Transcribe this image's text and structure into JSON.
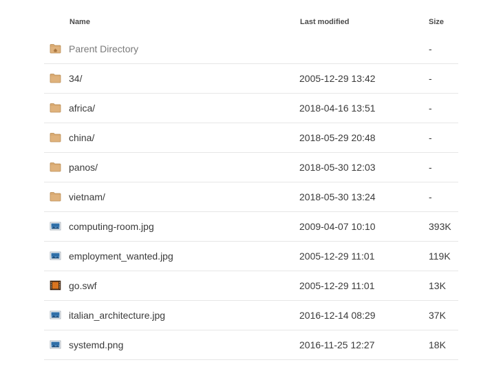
{
  "columns": {
    "name": "Name",
    "last_modified": "Last modified",
    "size": "Size"
  },
  "rows": [
    {
      "name": "Parent Directory",
      "modified": "",
      "size": "-",
      "icon": "parent-folder-icon"
    },
    {
      "name": "34/",
      "modified": "2005-12-29 13:42",
      "size": "-",
      "icon": "folder-icon"
    },
    {
      "name": "africa/",
      "modified": "2018-04-16 13:51",
      "size": "-",
      "icon": "folder-icon"
    },
    {
      "name": "china/",
      "modified": "2018-05-29 20:48",
      "size": "-",
      "icon": "folder-icon"
    },
    {
      "name": "panos/",
      "modified": "2018-05-30 12:03",
      "size": "-",
      "icon": "folder-icon"
    },
    {
      "name": "vietnam/",
      "modified": "2018-05-30 13:24",
      "size": "-",
      "icon": "folder-icon"
    },
    {
      "name": "computing-room.jpg",
      "modified": "2009-04-07 10:10",
      "size": "393K",
      "icon": "image-file-icon"
    },
    {
      "name": "employment_wanted.jpg",
      "modified": "2005-12-29 11:01",
      "size": "119K",
      "icon": "image-file-icon"
    },
    {
      "name": "go.swf",
      "modified": "2005-12-29 11:01",
      "size": "13K",
      "icon": "video-file-icon"
    },
    {
      "name": "italian_architecture.jpg",
      "modified": "2016-12-14 08:29",
      "size": "37K",
      "icon": "image-file-icon"
    },
    {
      "name": "systemd.png",
      "modified": "2016-11-25 12:27",
      "size": "18K",
      "icon": "image-file-icon"
    }
  ],
  "colors": {
    "folder": "#d9aa72",
    "folder_dark": "#b88a52",
    "image_frame": "#2f6fa8",
    "video_frame": "#c4621a",
    "divider": "#e6e6e6"
  }
}
